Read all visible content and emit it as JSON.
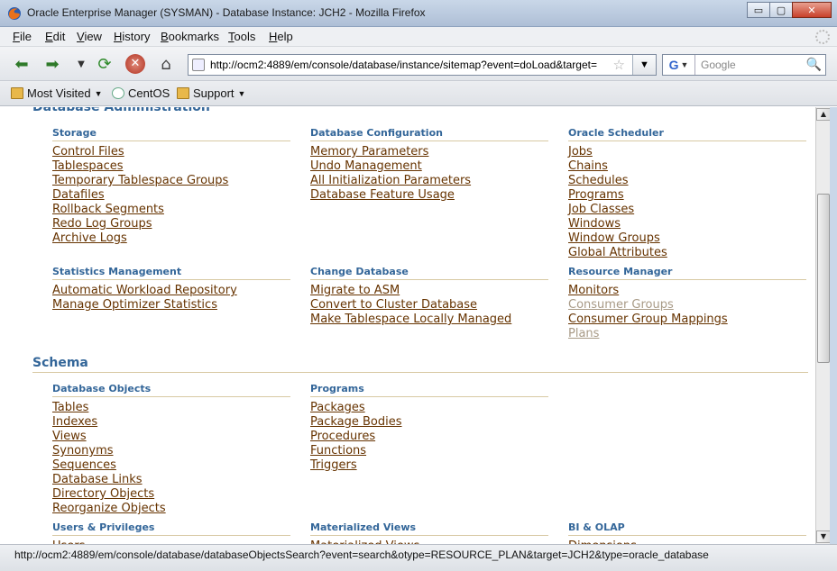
{
  "window": {
    "title": "Oracle Enterprise Manager (SYSMAN) - Database Instance: JCH2 - Mozilla Firefox",
    "minimize": "▭",
    "maximize": "▢",
    "close": "✕"
  },
  "menu": [
    "File",
    "Edit",
    "View",
    "History",
    "Bookmarks",
    "Tools",
    "Help"
  ],
  "nav": {
    "url": "http://ocm2:4889/em/console/database/instance/sitemap?event=doLoad&target=",
    "search_placeholder": "Google"
  },
  "bookmarks": [
    {
      "label": "Most Visited",
      "icon": "folder-icon",
      "dropdown": true
    },
    {
      "label": "CentOS",
      "icon": "page-icon",
      "dropdown": false
    },
    {
      "label": "Support",
      "icon": "folder-icon",
      "dropdown": true
    }
  ],
  "page": {
    "top_section": "Database Administration",
    "schema_section": "Schema",
    "admin_groups": [
      {
        "title": "Storage",
        "items": [
          {
            "label": "Control Files"
          },
          {
            "label": "Tablespaces"
          },
          {
            "label": "Temporary Tablespace Groups"
          },
          {
            "label": "Datafiles"
          },
          {
            "label": "Rollback Segments"
          },
          {
            "label": "Redo Log Groups"
          },
          {
            "label": "Archive Logs"
          }
        ]
      },
      {
        "title": "Database Configuration",
        "items": [
          {
            "label": "Memory Parameters"
          },
          {
            "label": "Undo Management"
          },
          {
            "label": "All Initialization Parameters"
          },
          {
            "label": "Database Feature Usage"
          }
        ]
      },
      {
        "title": "Oracle Scheduler",
        "items": [
          {
            "label": "Jobs"
          },
          {
            "label": "Chains"
          },
          {
            "label": "Schedules"
          },
          {
            "label": "Programs"
          },
          {
            "label": "Job Classes"
          },
          {
            "label": "Windows"
          },
          {
            "label": "Window Groups"
          },
          {
            "label": "Global Attributes"
          }
        ]
      },
      {
        "title": "Statistics Management",
        "items": [
          {
            "label": "Automatic Workload Repository"
          },
          {
            "label": "Manage Optimizer Statistics"
          }
        ]
      },
      {
        "title": "Change Database",
        "items": [
          {
            "label": "Migrate to ASM"
          },
          {
            "label": "Convert to Cluster Database"
          },
          {
            "label": "Make Tablespace Locally Managed"
          }
        ]
      },
      {
        "title": "Resource Manager",
        "items": [
          {
            "label": "Monitors"
          },
          {
            "label": "Consumer Groups",
            "disabled": true
          },
          {
            "label": "Consumer Group Mappings"
          },
          {
            "label": "Plans",
            "disabled": true
          }
        ]
      }
    ],
    "schema_groups": [
      {
        "title": "Database Objects",
        "items": [
          {
            "label": "Tables"
          },
          {
            "label": "Indexes"
          },
          {
            "label": "Views"
          },
          {
            "label": "Synonyms"
          },
          {
            "label": "Sequences"
          },
          {
            "label": "Database Links"
          },
          {
            "label": "Directory Objects"
          },
          {
            "label": "Reorganize Objects"
          }
        ]
      },
      {
        "title": "Programs",
        "items": [
          {
            "label": "Packages"
          },
          {
            "label": "Package Bodies"
          },
          {
            "label": "Procedures"
          },
          {
            "label": "Functions"
          },
          {
            "label": "Triggers"
          }
        ]
      },
      {
        "title": "Users & Privileges",
        "items": [
          {
            "label": "Users"
          }
        ]
      },
      {
        "title": "Materialized Views",
        "items": [
          {
            "label": "Materialized Views"
          }
        ]
      },
      {
        "title": "BI & OLAP",
        "items": [
          {
            "label": "Dimensions"
          }
        ]
      }
    ]
  },
  "status": "http://ocm2:4889/em/console/database/databaseObjectsSearch?event=search&otype=RESOURCE_PLAN&target=JCH2&type=oracle_database"
}
